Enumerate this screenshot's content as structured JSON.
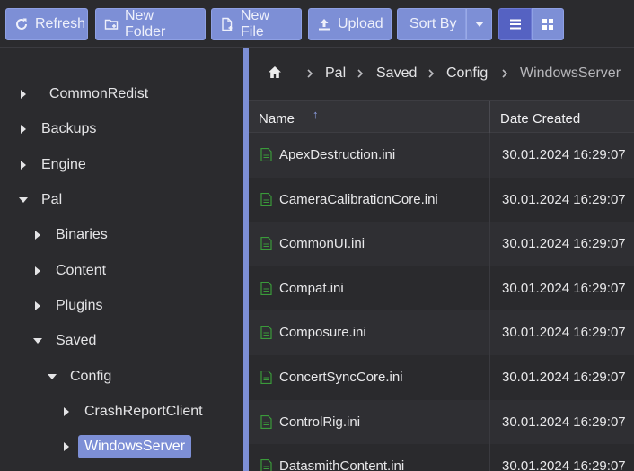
{
  "toolbar": {
    "refresh": "Refresh",
    "new_folder": "New Folder",
    "new_file": "New File",
    "upload": "Upload",
    "sort_by": "Sort By"
  },
  "tree": {
    "nodes": [
      {
        "label": "_CommonRedist",
        "expanded": false
      },
      {
        "label": "Backups",
        "expanded": false
      },
      {
        "label": "Engine",
        "expanded": false
      },
      {
        "label": "Pal",
        "expanded": true
      },
      {
        "label": "Binaries",
        "expanded": false
      },
      {
        "label": "Content",
        "expanded": false
      },
      {
        "label": "Plugins",
        "expanded": false
      },
      {
        "label": "Saved",
        "expanded": true
      },
      {
        "label": "Config",
        "expanded": true
      },
      {
        "label": "CrashReportClient",
        "expanded": false
      },
      {
        "label": "WindowsServer",
        "expanded": false,
        "selected": true
      }
    ]
  },
  "breadcrumb": {
    "items": [
      "Pal",
      "Saved",
      "Config",
      "WindowsServer"
    ]
  },
  "columns": {
    "name": "Name",
    "date_created": "Date Created"
  },
  "files": [
    {
      "name": "ApexDestruction.ini",
      "created": "30.01.2024 16:29:07"
    },
    {
      "name": "CameraCalibrationCore.ini",
      "created": "30.01.2024 16:29:07"
    },
    {
      "name": "CommonUI.ini",
      "created": "30.01.2024 16:29:07"
    },
    {
      "name": "Compat.ini",
      "created": "30.01.2024 16:29:07"
    },
    {
      "name": "Composure.ini",
      "created": "30.01.2024 16:29:07"
    },
    {
      "name": "ConcertSyncCore.ini",
      "created": "30.01.2024 16:29:07"
    },
    {
      "name": "ControlRig.ini",
      "created": "30.01.2024 16:29:07"
    },
    {
      "name": "DatasmithContent.ini",
      "created": "30.01.2024 16:29:07"
    }
  ],
  "colors": {
    "accent": "#7d8fd6",
    "accent_active": "#5562c2",
    "file_icon": "#3a9a3a",
    "background": "#2b2b2e"
  }
}
